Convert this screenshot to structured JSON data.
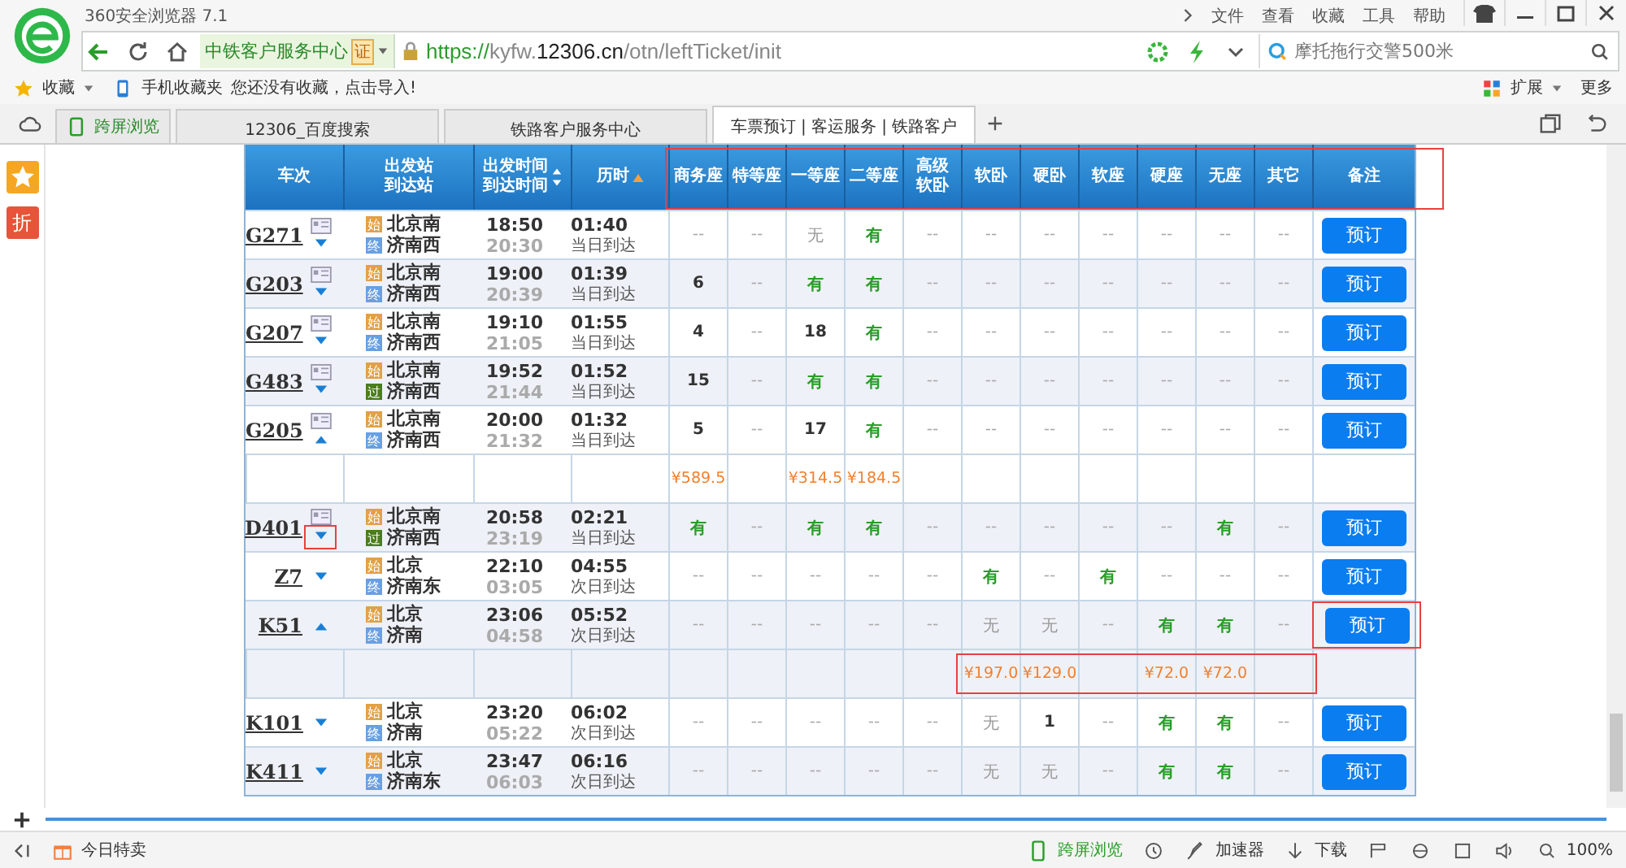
{
  "browser": {
    "title": "360安全浏览器 7.1",
    "menu": [
      "文件",
      "查看",
      "收藏",
      "工具",
      "帮助"
    ],
    "site_label": "中铁客户服务中心",
    "cert_badge": "证",
    "url": {
      "scheme": "https://",
      "host": "kyfw.",
      "domain": "12306.cn",
      "path": "/otn/leftTicket/init"
    },
    "search": {
      "value": "摩托拖行交警500米"
    },
    "bookmarks": {
      "label": "收藏",
      "mobile": "手机收藏夹",
      "hint": "您还没有收藏，点击导入!",
      "extensions": "扩展",
      "more": "更多"
    },
    "tabs": [
      {
        "label": "跨屏浏览",
        "kind": "cross",
        "selected": false
      },
      {
        "label": "12306_百度搜索",
        "kind": "page",
        "selected": false
      },
      {
        "label": "铁路客户服务中心",
        "kind": "page",
        "selected": false
      },
      {
        "label": "车票预订 | 客运服务 | 铁路客户",
        "kind": "page",
        "selected": true
      }
    ]
  },
  "sidebar": {
    "discount_badge": "折"
  },
  "table": {
    "header_annotated": true,
    "columns": [
      {
        "lines": [
          "车次"
        ],
        "kind": "plain"
      },
      {
        "lines": [
          "出发站",
          "到达站"
        ],
        "kind": "plain"
      },
      {
        "lines": [
          "出发时间",
          "到达时间"
        ],
        "kind": "sortable_pair"
      },
      {
        "lines": [
          "历时"
        ],
        "kind": "sorted_asc"
      },
      {
        "lines": [
          "商务座"
        ],
        "kind": "plain"
      },
      {
        "lines": [
          "特等座"
        ],
        "kind": "plain"
      },
      {
        "lines": [
          "一等座"
        ],
        "kind": "plain"
      },
      {
        "lines": [
          "二等座"
        ],
        "kind": "plain"
      },
      {
        "lines": [
          "高级",
          "软卧"
        ],
        "kind": "plain"
      },
      {
        "lines": [
          "软卧"
        ],
        "kind": "plain"
      },
      {
        "lines": [
          "硬卧"
        ],
        "kind": "plain"
      },
      {
        "lines": [
          "软座"
        ],
        "kind": "plain"
      },
      {
        "lines": [
          "硬座"
        ],
        "kind": "plain"
      },
      {
        "lines": [
          "无座"
        ],
        "kind": "plain"
      },
      {
        "lines": [
          "其它"
        ],
        "kind": "plain"
      },
      {
        "lines": [
          "备注"
        ],
        "kind": "plain"
      }
    ],
    "rows": [
      {
        "train": "G271",
        "info_icon": true,
        "expanded": false,
        "arrow_annotated": false,
        "from": {
          "badge": "始",
          "kind": "start",
          "name": "北京南"
        },
        "to": {
          "badge": "终",
          "kind": "end",
          "name": "济南西"
        },
        "depart": "18:50",
        "arrive": "20:30",
        "duration": "01:40",
        "arrival_day": "当日到达",
        "book": "预订",
        "book_annotated": false,
        "seats": [
          {
            "text": "--",
            "kind": "dash"
          },
          {
            "text": "--",
            "kind": "dash"
          },
          {
            "text": "无",
            "kind": "none"
          },
          {
            "text": "有",
            "kind": "avail"
          },
          {
            "text": "--",
            "kind": "dash"
          },
          {
            "text": "--",
            "kind": "dash"
          },
          {
            "text": "--",
            "kind": "dash"
          },
          {
            "text": "--",
            "kind": "dash"
          },
          {
            "text": "--",
            "kind": "dash"
          },
          {
            "text": "--",
            "kind": "dash"
          },
          {
            "text": "--",
            "kind": "dash"
          }
        ]
      },
      {
        "train": "G203",
        "info_icon": true,
        "expanded": false,
        "arrow_annotated": false,
        "from": {
          "badge": "始",
          "kind": "start",
          "name": "北京南"
        },
        "to": {
          "badge": "终",
          "kind": "end",
          "name": "济南西"
        },
        "depart": "19:00",
        "arrive": "20:39",
        "duration": "01:39",
        "arrival_day": "当日到达",
        "book": "预订",
        "book_annotated": false,
        "seats": [
          {
            "text": "6",
            "kind": "count"
          },
          {
            "text": "--",
            "kind": "dash"
          },
          {
            "text": "有",
            "kind": "avail"
          },
          {
            "text": "有",
            "kind": "avail"
          },
          {
            "text": "--",
            "kind": "dash"
          },
          {
            "text": "--",
            "kind": "dash"
          },
          {
            "text": "--",
            "kind": "dash"
          },
          {
            "text": "--",
            "kind": "dash"
          },
          {
            "text": "--",
            "kind": "dash"
          },
          {
            "text": "--",
            "kind": "dash"
          },
          {
            "text": "--",
            "kind": "dash"
          }
        ]
      },
      {
        "train": "G207",
        "info_icon": true,
        "expanded": false,
        "arrow_annotated": false,
        "from": {
          "badge": "始",
          "kind": "start",
          "name": "北京南"
        },
        "to": {
          "badge": "终",
          "kind": "end",
          "name": "济南西"
        },
        "depart": "19:10",
        "arrive": "21:05",
        "duration": "01:55",
        "arrival_day": "当日到达",
        "book": "预订",
        "book_annotated": false,
        "seats": [
          {
            "text": "4",
            "kind": "count"
          },
          {
            "text": "--",
            "kind": "dash"
          },
          {
            "text": "18",
            "kind": "count"
          },
          {
            "text": "有",
            "kind": "avail"
          },
          {
            "text": "--",
            "kind": "dash"
          },
          {
            "text": "--",
            "kind": "dash"
          },
          {
            "text": "--",
            "kind": "dash"
          },
          {
            "text": "--",
            "kind": "dash"
          },
          {
            "text": "--",
            "kind": "dash"
          },
          {
            "text": "--",
            "kind": "dash"
          },
          {
            "text": "--",
            "kind": "dash"
          }
        ]
      },
      {
        "train": "G483",
        "info_icon": true,
        "expanded": false,
        "arrow_annotated": false,
        "from": {
          "badge": "始",
          "kind": "start",
          "name": "北京南"
        },
        "to": {
          "badge": "过",
          "kind": "pass",
          "name": "济南西"
        },
        "depart": "19:52",
        "arrive": "21:44",
        "duration": "01:52",
        "arrival_day": "当日到达",
        "book": "预订",
        "book_annotated": false,
        "seats": [
          {
            "text": "15",
            "kind": "count"
          },
          {
            "text": "--",
            "kind": "dash"
          },
          {
            "text": "有",
            "kind": "avail"
          },
          {
            "text": "有",
            "kind": "avail"
          },
          {
            "text": "--",
            "kind": "dash"
          },
          {
            "text": "--",
            "kind": "dash"
          },
          {
            "text": "--",
            "kind": "dash"
          },
          {
            "text": "--",
            "kind": "dash"
          },
          {
            "text": "--",
            "kind": "dash"
          },
          {
            "text": "--",
            "kind": "dash"
          },
          {
            "text": "--",
            "kind": "dash"
          }
        ]
      },
      {
        "train": "G205",
        "info_icon": true,
        "expanded": true,
        "arrow_annotated": false,
        "from": {
          "badge": "始",
          "kind": "start",
          "name": "北京南"
        },
        "to": {
          "badge": "终",
          "kind": "end",
          "name": "济南西"
        },
        "depart": "20:00",
        "arrive": "21:32",
        "duration": "01:32",
        "arrival_day": "当日到达",
        "book": "预订",
        "book_annotated": false,
        "seats": [
          {
            "text": "5",
            "kind": "count"
          },
          {
            "text": "--",
            "kind": "dash"
          },
          {
            "text": "17",
            "kind": "count"
          },
          {
            "text": "有",
            "kind": "avail"
          },
          {
            "text": "--",
            "kind": "dash"
          },
          {
            "text": "--",
            "kind": "dash"
          },
          {
            "text": "--",
            "kind": "dash"
          },
          {
            "text": "--",
            "kind": "dash"
          },
          {
            "text": "--",
            "kind": "dash"
          },
          {
            "text": "--",
            "kind": "dash"
          },
          {
            "text": "--",
            "kind": "dash"
          }
        ],
        "prices_annotated": false,
        "prices": {
          "business": "¥589.5",
          "first": "¥314.5",
          "second": "¥184.5"
        }
      },
      {
        "train": "D401",
        "info_icon": true,
        "expanded": false,
        "arrow_annotated": true,
        "from": {
          "badge": "始",
          "kind": "start",
          "name": "北京南"
        },
        "to": {
          "badge": "过",
          "kind": "pass",
          "name": "济南西"
        },
        "depart": "20:58",
        "arrive": "23:19",
        "duration": "02:21",
        "arrival_day": "当日到达",
        "book": "预订",
        "book_annotated": false,
        "seats": [
          {
            "text": "有",
            "kind": "avail"
          },
          {
            "text": "--",
            "kind": "dash"
          },
          {
            "text": "有",
            "kind": "avail"
          },
          {
            "text": "有",
            "kind": "avail"
          },
          {
            "text": "--",
            "kind": "dash"
          },
          {
            "text": "--",
            "kind": "dash"
          },
          {
            "text": "--",
            "kind": "dash"
          },
          {
            "text": "--",
            "kind": "dash"
          },
          {
            "text": "--",
            "kind": "dash"
          },
          {
            "text": "有",
            "kind": "avail"
          },
          {
            "text": "--",
            "kind": "dash"
          }
        ]
      },
      {
        "train": "Z7",
        "info_icon": false,
        "expanded": false,
        "arrow_annotated": false,
        "from": {
          "badge": "始",
          "kind": "start",
          "name": "北京"
        },
        "to": {
          "badge": "终",
          "kind": "end",
          "name": "济南东"
        },
        "depart": "22:10",
        "arrive": "03:05",
        "duration": "04:55",
        "arrival_day": "次日到达",
        "book": "预订",
        "book_annotated": false,
        "seats": [
          {
            "text": "--",
            "kind": "dash"
          },
          {
            "text": "--",
            "kind": "dash"
          },
          {
            "text": "--",
            "kind": "dash"
          },
          {
            "text": "--",
            "kind": "dash"
          },
          {
            "text": "--",
            "kind": "dash"
          },
          {
            "text": "有",
            "kind": "avail"
          },
          {
            "text": "--",
            "kind": "dash"
          },
          {
            "text": "有",
            "kind": "avail"
          },
          {
            "text": "--",
            "kind": "dash"
          },
          {
            "text": "--",
            "kind": "dash"
          },
          {
            "text": "--",
            "kind": "dash"
          }
        ]
      },
      {
        "train": "K51",
        "info_icon": false,
        "expanded": true,
        "arrow_annotated": false,
        "from": {
          "badge": "始",
          "kind": "start",
          "name": "北京"
        },
        "to": {
          "badge": "终",
          "kind": "end",
          "name": "济南"
        },
        "depart": "23:06",
        "arrive": "04:58",
        "duration": "05:52",
        "arrival_day": "次日到达",
        "book": "预订",
        "book_annotated": true,
        "seats": [
          {
            "text": "--",
            "kind": "dash"
          },
          {
            "text": "--",
            "kind": "dash"
          },
          {
            "text": "--",
            "kind": "dash"
          },
          {
            "text": "--",
            "kind": "dash"
          },
          {
            "text": "--",
            "kind": "dash"
          },
          {
            "text": "无",
            "kind": "none"
          },
          {
            "text": "无",
            "kind": "none"
          },
          {
            "text": "--",
            "kind": "dash"
          },
          {
            "text": "有",
            "kind": "avail"
          },
          {
            "text": "有",
            "kind": "avail"
          },
          {
            "text": "--",
            "kind": "dash"
          }
        ],
        "prices_annotated": true,
        "prices": {
          "soft_sleeper": "¥197.0",
          "hard_sleeper": "¥129.0",
          "hard_seat": "¥72.0",
          "standing": "¥72.0"
        }
      },
      {
        "train": "K101",
        "info_icon": false,
        "expanded": false,
        "arrow_annotated": false,
        "from": {
          "badge": "始",
          "kind": "start",
          "name": "北京"
        },
        "to": {
          "badge": "终",
          "kind": "end",
          "name": "济南"
        },
        "depart": "23:20",
        "arrive": "05:22",
        "duration": "06:02",
        "arrival_day": "次日到达",
        "book": "预订",
        "book_annotated": false,
        "seats": [
          {
            "text": "--",
            "kind": "dash"
          },
          {
            "text": "--",
            "kind": "dash"
          },
          {
            "text": "--",
            "kind": "dash"
          },
          {
            "text": "--",
            "kind": "dash"
          },
          {
            "text": "--",
            "kind": "dash"
          },
          {
            "text": "无",
            "kind": "none"
          },
          {
            "text": "1",
            "kind": "count"
          },
          {
            "text": "--",
            "kind": "dash"
          },
          {
            "text": "有",
            "kind": "avail"
          },
          {
            "text": "有",
            "kind": "avail"
          },
          {
            "text": "--",
            "kind": "dash"
          }
        ]
      },
      {
        "train": "K411",
        "info_icon": false,
        "expanded": false,
        "arrow_annotated": false,
        "from": {
          "badge": "始",
          "kind": "start",
          "name": "北京"
        },
        "to": {
          "badge": "终",
          "kind": "end",
          "name": "济南东"
        },
        "depart": "23:47",
        "arrive": "06:03",
        "duration": "06:16",
        "arrival_day": "次日到达",
        "book": "预订",
        "book_annotated": false,
        "seats": [
          {
            "text": "--",
            "kind": "dash"
          },
          {
            "text": "--",
            "kind": "dash"
          },
          {
            "text": "--",
            "kind": "dash"
          },
          {
            "text": "--",
            "kind": "dash"
          },
          {
            "text": "--",
            "kind": "dash"
          },
          {
            "text": "无",
            "kind": "none"
          },
          {
            "text": "无",
            "kind": "none"
          },
          {
            "text": "--",
            "kind": "dash"
          },
          {
            "text": "有",
            "kind": "avail"
          },
          {
            "text": "有",
            "kind": "avail"
          },
          {
            "text": "--",
            "kind": "dash"
          }
        ]
      }
    ]
  },
  "status_bar": {
    "deals": "今日特卖",
    "cross": "跨屏浏览",
    "accelerator": "加速器",
    "download": "下载",
    "zoom": "100%"
  }
}
